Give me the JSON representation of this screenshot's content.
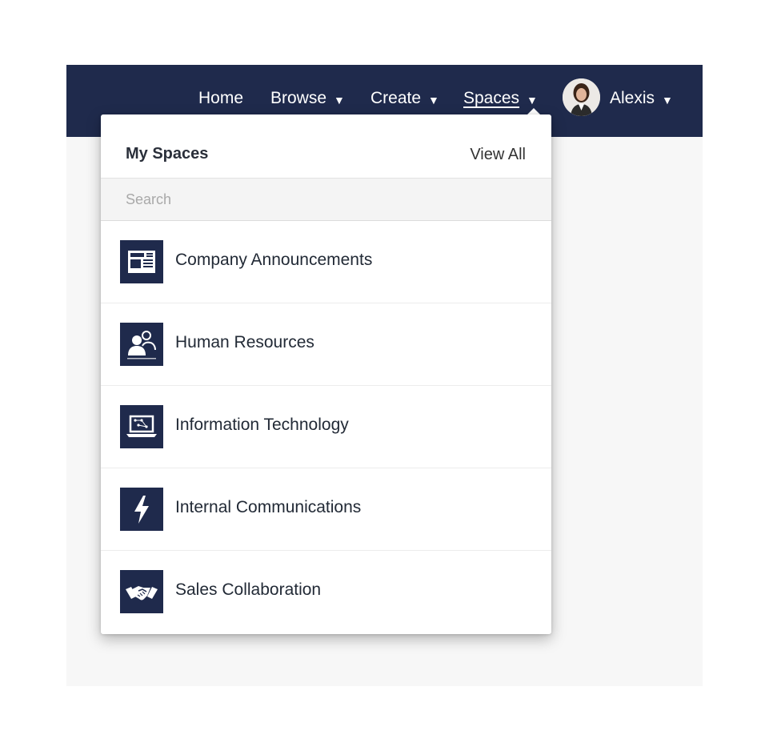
{
  "navbar": {
    "items": [
      {
        "label": "Home"
      },
      {
        "label": "Browse",
        "caret": "▼"
      },
      {
        "label": "Create",
        "caret": "▼"
      },
      {
        "label": "Spaces",
        "caret": "▼"
      }
    ],
    "user": {
      "name": "Alexis",
      "caret": "▼",
      "avatar_icon": "user-avatar"
    },
    "color": "#1f2a4c"
  },
  "dropdown": {
    "title": "My Spaces",
    "view_all": "View All",
    "search": {
      "placeholder": "Search",
      "value": ""
    },
    "items": [
      {
        "label": "Company Announcements",
        "icon": "newspaper-icon"
      },
      {
        "label": "Human Resources",
        "icon": "people-icon"
      },
      {
        "label": "Information Technology",
        "icon": "laptop-icon"
      },
      {
        "label": "Internal Communications",
        "icon": "lightning-icon"
      },
      {
        "label": "Sales Collaboration",
        "icon": "handshake-icon"
      }
    ]
  }
}
